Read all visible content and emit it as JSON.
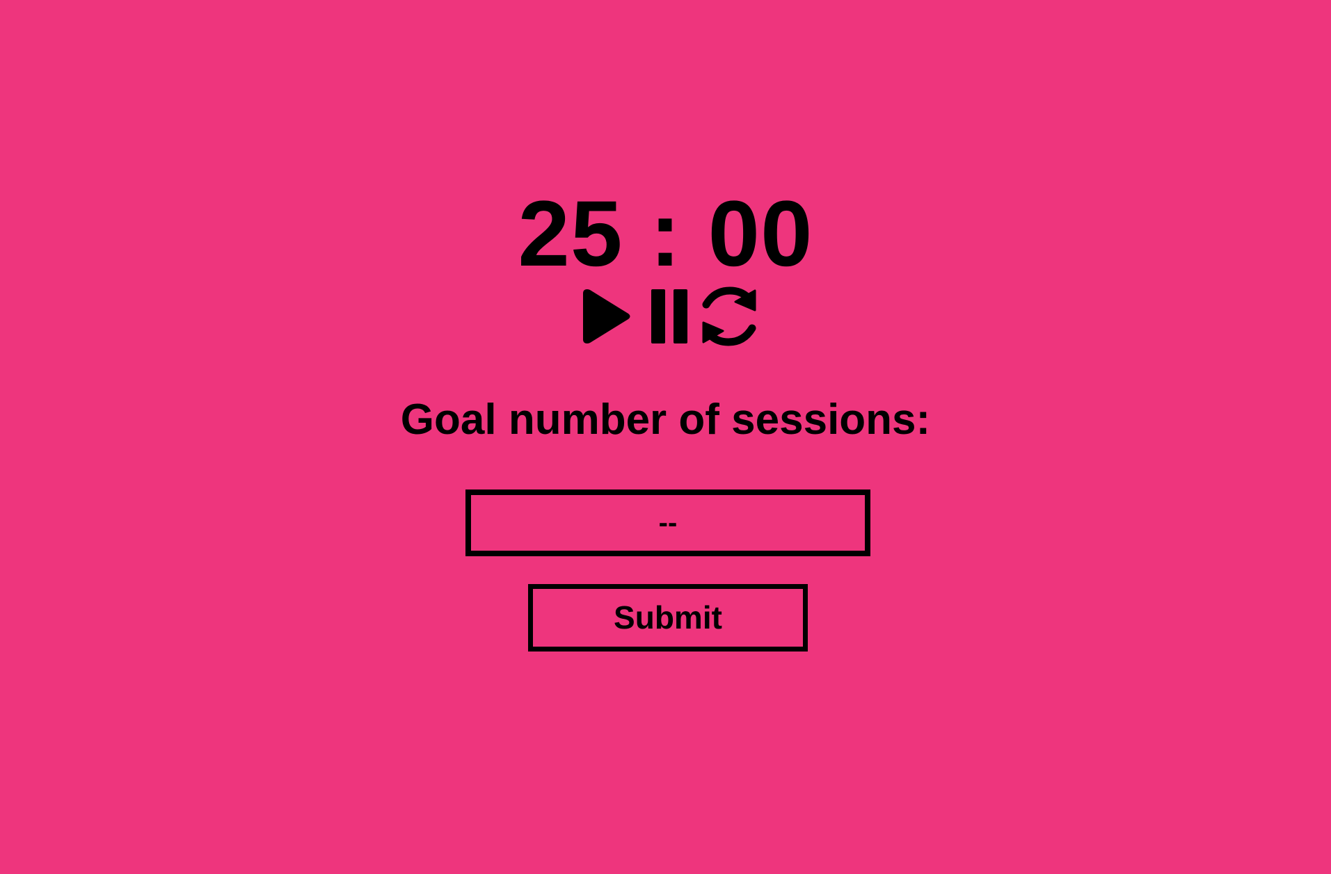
{
  "timer": {
    "display": "25 : 00",
    "minutes": "25",
    "seconds": "00"
  },
  "controls": {
    "play_icon": "play-icon",
    "pause_icon": "pause-icon",
    "reset_icon": "reset-icon"
  },
  "goal": {
    "label": "Goal number of sessions:",
    "input_value": "",
    "input_placeholder": "--"
  },
  "submit": {
    "label": "Submit"
  },
  "colors": {
    "background": "#ee357d",
    "foreground": "#000000"
  }
}
